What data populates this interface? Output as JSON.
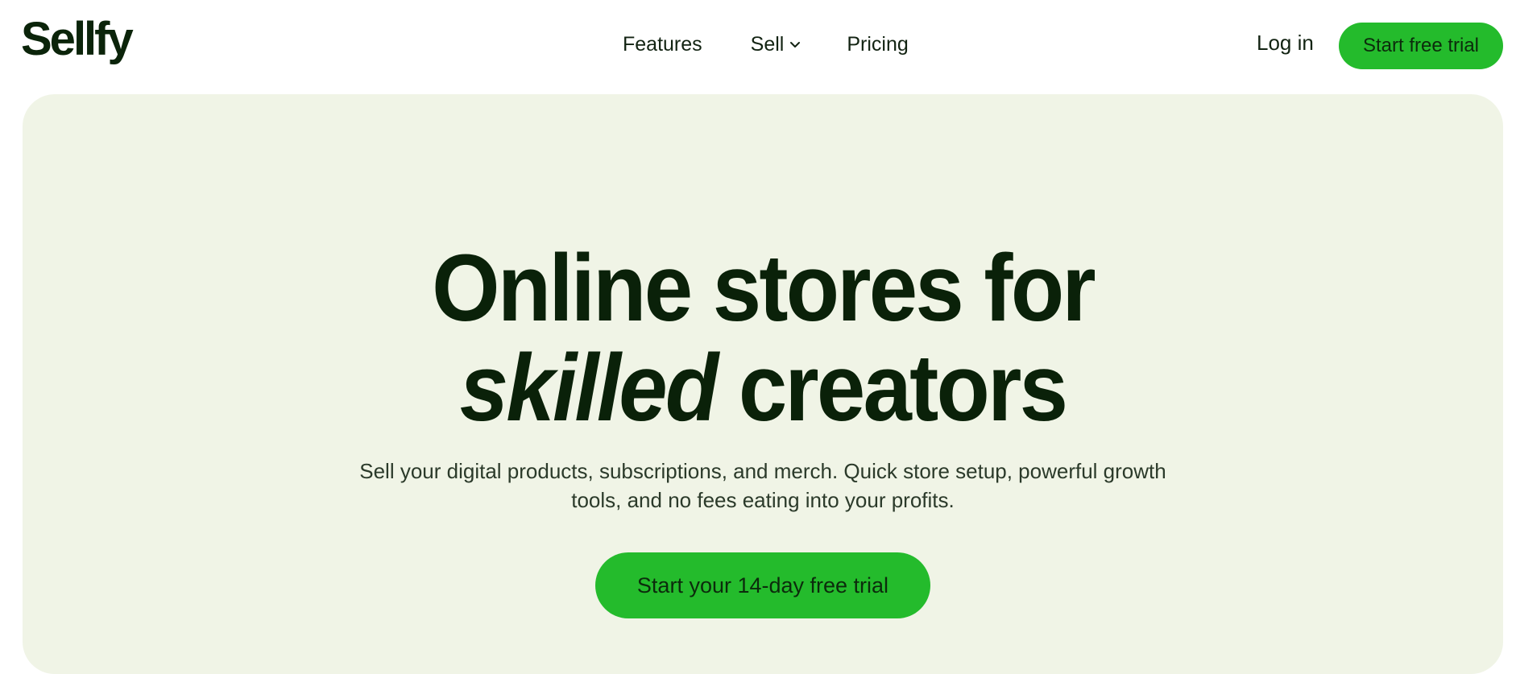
{
  "header": {
    "logo_text": "Sellfy",
    "nav": {
      "features": "Features",
      "sell": "Sell",
      "pricing": "Pricing"
    },
    "login": "Log in",
    "cta": "Start free trial"
  },
  "hero": {
    "title_line1": "Online stores for",
    "title_emphasis": "skilled",
    "title_line2_rest": "creators",
    "subtitle_line1": "Sell your digital products, subscriptions, and merch. Quick store setup, powerful growth",
    "subtitle_line2": "tools, and no fees eating into your profits.",
    "cta": "Start your 14-day free trial"
  },
  "colors": {
    "brand_green": "#24bb2c",
    "dark_green": "#0a2109",
    "hero_bg": "#f0f4e6"
  },
  "icons": {
    "sell_dropdown": "chevron-down-icon"
  }
}
